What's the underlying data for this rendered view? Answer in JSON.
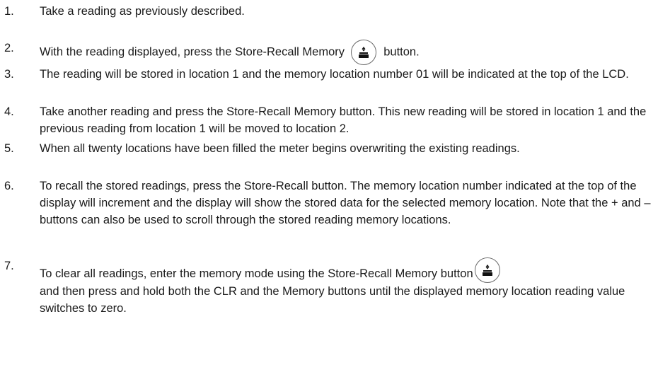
{
  "steps": [
    {
      "num": "1.",
      "text": "Take a reading as previously described."
    },
    {
      "num": "2.",
      "text_before": "With the reading displayed, press the Store-Recall Memory",
      "text_after": "button.",
      "icon": "store-recall-memory-icon"
    },
    {
      "num": "3.",
      "text": "The reading will be stored in location 1 and the memory location number 01 will be indicated at the top of the LCD."
    },
    {
      "num": "4.",
      "text": "Take another reading and press the Store-Recall Memory button. This new reading will be stored in location 1 and the previous reading from location 1 will be moved to location 2."
    },
    {
      "num": "5.",
      "text": "When all twenty locations have been filled the meter begins overwriting the existing readings."
    },
    {
      "num": "6.",
      "text": "To recall the stored readings, press the Store-Recall button. The memory location number indicated at the top of the display will increment and the display will show the stored data for the selected memory location. Note that the + and – buttons can also be used to scroll through the stored reading memory locations."
    },
    {
      "num": "7.",
      "text_before": "To clear all readings, enter the memory mode using the Store-Recall Memory button",
      "text_after": "and then press and hold both the CLR and the Memory buttons until the displayed memory location reading value switches to zero.",
      "icon": "store-recall-memory-icon"
    }
  ]
}
